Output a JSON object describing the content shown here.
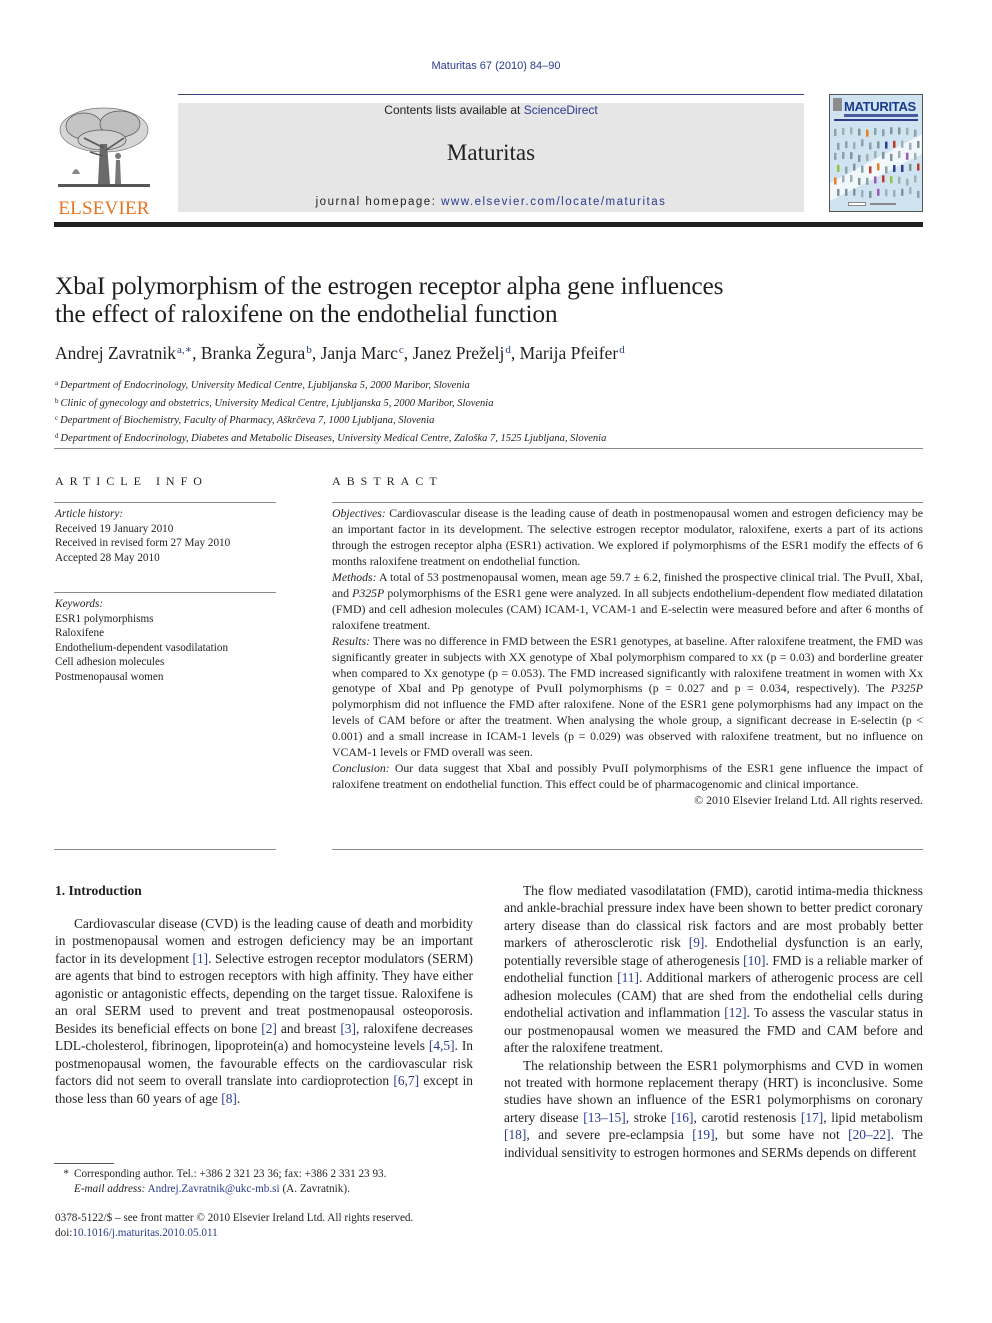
{
  "header": {
    "citation": "Maturitas 67 (2010) 84–90",
    "contents_prefix": "Contents lists available at ",
    "contents_link": "ScienceDirect",
    "journal_name": "Maturitas",
    "homepage_prefix": "journal homepage: ",
    "homepage_link": "www.elsevier.com/locate/maturitas",
    "publisher_logo_text": "ELSEVIER",
    "cover_title": "MATURITAS",
    "colors": {
      "link": "#2b3a8c",
      "publisher_orange": "#e8731e",
      "banner_gray": "#e6e6e7",
      "text": "#231f20"
    }
  },
  "article": {
    "title_line1": "XbaI polymorphism of the estrogen receptor alpha gene influences",
    "title_line2": "the effect of raloxifene on the endothelial function",
    "authors": [
      {
        "name": "Andrej Zavratnik",
        "sup": "a,∗",
        "sep": ", "
      },
      {
        "name": "Branka Žegura",
        "sup": "b",
        "sep": ", "
      },
      {
        "name": "Janja Marc",
        "sup": "c",
        "sep": ", "
      },
      {
        "name": "Janez Preželj",
        "sup": "d",
        "sep": ", "
      },
      {
        "name": "Marija Pfeifer",
        "sup": "d",
        "sep": ""
      }
    ],
    "affiliations": [
      {
        "sup": "a",
        "text": "Department of Endocrinology, University Medical Centre, Ljubljanska 5, 2000 Maribor, Slovenia"
      },
      {
        "sup": "b",
        "text": "Clinic of gynecology and obstetrics, University Medical Centre, Ljubljanska 5, 2000 Maribor, Slovenia"
      },
      {
        "sup": "c",
        "text": "Department of Biochemistry, Faculty of Pharmacy, Aškrčeva 7, 1000 Ljubljana, Slovenia"
      },
      {
        "sup": "d",
        "text": "Department of Endocrinology, Diabetes and Metabolic Diseases, University Medical Centre, Zaloška 7, 1525 Ljubljana, Slovenia"
      }
    ]
  },
  "article_info": {
    "heading": "ARTICLE INFO",
    "history_label": "Article history:",
    "history": [
      "Received 19 January 2010",
      "Received in revised form 27 May 2010",
      "Accepted 28 May 2010"
    ],
    "keywords_label": "Keywords:",
    "keywords": [
      "ESR1 polymorphisms",
      "Raloxifene",
      "Endothelium-dependent vasodilatation",
      "Cell adhesion molecules",
      "Postmenopausal women"
    ]
  },
  "abstract": {
    "heading": "ABSTRACT",
    "objectives_label": "Objectives:",
    "objectives": " Cardiovascular disease is the leading cause of death in postmenopausal women and estrogen deficiency may be an important factor in its development. The selective estrogen receptor modulator, raloxifene, exerts a part of its actions through the estrogen receptor alpha (ESR1) activation. We explored if polymorphisms of the ESR1 modify the effects of 6 months raloxifene treatment on endothelial function.",
    "methods_label": "Methods:",
    "methods_a": " A total of 53 postmenopausal women, mean age 59.7 ± 6.2, finished the prospective clinical trial. The PvuII, XbaI, and ",
    "methods_italic": "P325P",
    "methods_b": " polymorphisms of the ESR1 gene were analyzed. In all subjects endothelium-dependent flow mediated dilatation (FMD) and cell adhesion molecules (CAM) ICAM-1, VCAM-1 and E-selectin were measured before and after 6 months of raloxifene treatment.",
    "results_label": "Results:",
    "results_a": " There was no difference in FMD between the ESR1 genotypes, at baseline. After raloxifene treatment, the FMD was significantly greater in subjects with XX genotype of XbaI polymorphism compared to xx (p = 0.03) and borderline greater when compared to Xx genotype (p = 0.053). The FMD increased significantly with raloxifene treatment in women with Xx genotype of XbaI and Pp genotype of PvuII polymorphisms (p = 0.027 and p = 0.034, respectively). The ",
    "results_italic": "P325P",
    "results_b": " polymorphism did not influence the FMD after raloxifene. None of the ESR1 gene polymorphisms had any impact on the levels of CAM before or after the treatment. When analysing the whole group, a significant decrease in E-selectin (p < 0.001) and a small increase in ICAM-1 levels (p = 0.029) was observed with raloxifene treatment, but no influence on VCAM-1 levels or FMD overall was seen.",
    "conclusion_label": "Conclusion:",
    "conclusion": " Our data suggest that XbaI and possibly PvuII polymorphisms of the ESR1 gene influence the impact of raloxifene treatment on endothelial function. This effect could be of pharmacogenomic and clinical importance.",
    "copyright": "© 2010 Elsevier Ireland Ltd. All rights reserved."
  },
  "body": {
    "intro_heading": "1.  Introduction",
    "left_p1": [
      {
        "t": "Cardiovascular disease (CVD) is the leading cause of death and morbidity in postmenopausal women and estrogen deficiency may be an important factor in its development "
      },
      {
        "ref": "[1]"
      },
      {
        "t": ". Selective estrogen receptor modulators (SERM) are agents that bind to estrogen receptors with high affinity. They have either agonistic or antagonistic effects, depending on the target tissue. Raloxifene is an oral SERM used to prevent and treat postmenopausal osteoporosis. Besides its beneficial effects on bone "
      },
      {
        "ref": "[2]"
      },
      {
        "t": " and breast "
      },
      {
        "ref": "[3]"
      },
      {
        "t": ", raloxifene decreases LDL-cholesterol, fibrinogen, lipoprotein(a) and homocysteine levels "
      },
      {
        "ref": "[4,5]"
      },
      {
        "t": ". In postmenopausal women, the favourable effects on the cardiovascular risk factors did not seem to overall translate into cardioprotection "
      },
      {
        "ref": "[6,7]"
      },
      {
        "t": " except in those less than 60 years of age "
      },
      {
        "ref": "[8]"
      },
      {
        "t": "."
      }
    ],
    "right_p1": [
      {
        "t": "The flow mediated vasodilatation (FMD), carotid intima-media thickness and ankle-brachial pressure index have been shown to better predict coronary artery disease than do classical risk factors and are most probably better markers of atherosclerotic risk "
      },
      {
        "ref": "[9]"
      },
      {
        "t": ". Endothelial dysfunction is an early, potentially reversible stage of atherogenesis "
      },
      {
        "ref": "[10]"
      },
      {
        "t": ". FMD is a reliable marker of endothelial function "
      },
      {
        "ref": "[11]"
      },
      {
        "t": ". Additional markers of atherogenic process are cell adhesion molecules (CAM) that are shed from the endothelial cells during endothelial activation and inflammation "
      },
      {
        "ref": "[12]"
      },
      {
        "t": ". To assess the vascular status in our postmenopausal women we measured the FMD and CAM before and after the raloxifene treatment."
      }
    ],
    "right_p2": [
      {
        "t": "The relationship between the ESR1 polymorphisms and CVD in women not treated with hormone replacement therapy (HRT) is inconclusive. Some studies have shown an influence of the ESR1 polymorphisms on coronary artery disease "
      },
      {
        "ref": "[13–15]"
      },
      {
        "t": ", stroke "
      },
      {
        "ref": "[16]"
      },
      {
        "t": ", carotid restenosis "
      },
      {
        "ref": "[17]"
      },
      {
        "t": ", lipid metabolism "
      },
      {
        "ref": "[18]"
      },
      {
        "t": ", and severe pre-eclampsia "
      },
      {
        "ref": "[19]"
      },
      {
        "t": ", but some have not "
      },
      {
        "ref": "[20–22]"
      },
      {
        "t": ". The individual sensitivity to estrogen hormones and SERMs depends on different"
      }
    ]
  },
  "footnote": {
    "star": "*",
    "corresponding": "Corresponding author. Tel.: +386 2 321 23 36; fax: +386 2 331 23 93.",
    "email_label": "E-mail address:",
    "email": "Andrej.Zavratnik@ukc-mb.si",
    "email_suffix": " (A. Zavratnik).",
    "front_matter": "0378-5122/$ – see front matter © 2010 Elsevier Ireland Ltd. All rights reserved.",
    "doi_label": "doi:",
    "doi": "10.1016/j.maturitas.2010.05.011"
  }
}
